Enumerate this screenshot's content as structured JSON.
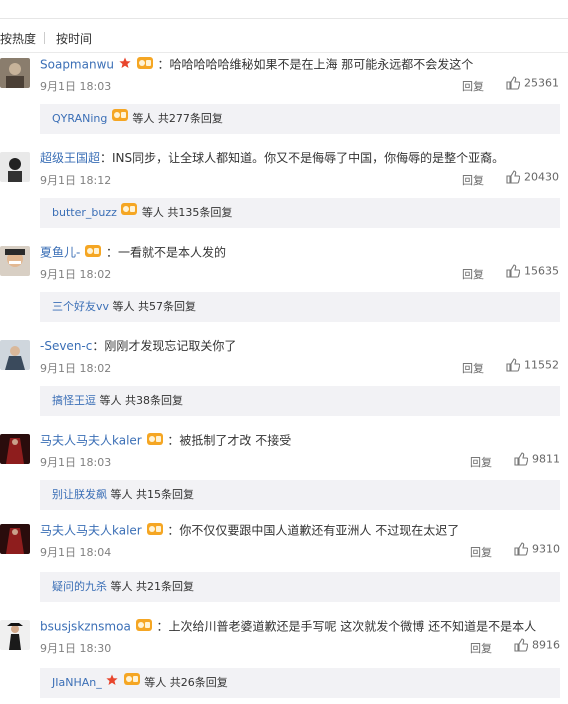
{
  "sort_tabs": [
    "按热度",
    "按时间"
  ],
  "reply_label": "回复",
  "comments": [
    {
      "user": "Soapmanwu",
      "text": "：哈哈哈哈哈维秘如果不是在上海 那可能永远都不会发这个",
      "time": "9月1日 18:03",
      "likes": "25361",
      "reply_user": "QYRANing",
      "reply_suffix": "等人 共277条回复"
    },
    {
      "user": "超级王国超",
      "text": "：INS同步，让全球人都知道。你又不是侮辱了中国，你侮辱的是整个亚裔。",
      "time": "9月1日 18:12",
      "likes": "20430",
      "reply_user": "butter_buzz",
      "reply_suffix": "等人 共135条回复"
    },
    {
      "user": "夏鱼儿-",
      "text": "：一看就不是本人发的",
      "time": "9月1日 18:02",
      "likes": "15635",
      "reply_user": "三个好友vv",
      "reply_suffix": "等人 共57条回复"
    },
    {
      "user": "-Seven-c",
      "text": "：刚刚才发现忘记取关你了",
      "time": "9月1日 18:02",
      "likes": "11552",
      "reply_user": "搞怪王逗",
      "reply_suffix": "等人 共38条回复"
    },
    {
      "user": "马夫人马夫人kaler",
      "text": "：被抵制了才改 不接受",
      "time": "9月1日 18:03",
      "likes": "9811",
      "reply_user": "别让朕发飙",
      "reply_suffix": "等人 共15条回复"
    },
    {
      "user": "马夫人马夫人kaler",
      "text": "：你不仅仅要跟中国人道歉还有亚洲人 不过现在太迟了",
      "time": "9月1日 18:04",
      "likes": "9310",
      "reply_user": "疑问的九杀",
      "reply_suffix": "等人 共21条回复"
    },
    {
      "user": "bsusjskznsmoa",
      "text": "：上次给川普老婆道歉还是手写呢 这次就发个微博 还不知道是不是本人",
      "time": "9月1日 18:30",
      "likes": "8916",
      "reply_user": "JIaNHAn_",
      "reply_suffix": "等人 共26条回复"
    }
  ]
}
